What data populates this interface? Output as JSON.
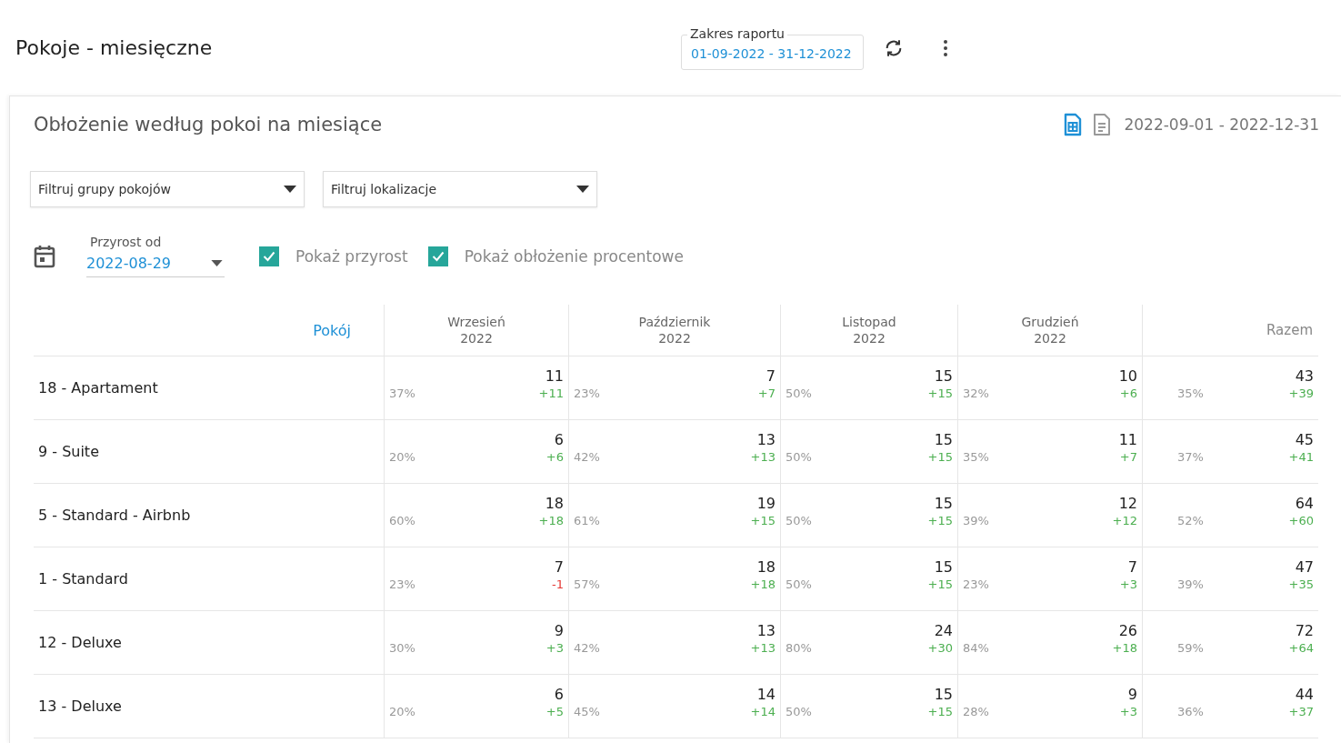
{
  "page_title": "Pokoje - miesięczne",
  "report_range": {
    "label": "Zakres raportu",
    "value": "01-09-2022 - 31-12-2022"
  },
  "card": {
    "title": "Obłożenie według pokoi na miesiące",
    "date_range": "2022-09-01 - 2022-12-31"
  },
  "filters": [
    {
      "placeholder": "Filtruj grupy pokojów"
    },
    {
      "placeholder": "Filtruj lokalizacje"
    }
  ],
  "growth_from": {
    "label": "Przyrost od",
    "value": "2022-08-29"
  },
  "checkboxes": [
    {
      "label": "Pokaż przyrost",
      "checked": true
    },
    {
      "label": "Pokaż obłożenie procentowe",
      "checked": true
    }
  ],
  "table": {
    "columns": [
      {
        "label": "Pokój",
        "kind": "room"
      },
      {
        "label": "Wrzesień",
        "year": "2022",
        "kind": "month"
      },
      {
        "label": "Październik",
        "year": "2022",
        "kind": "month"
      },
      {
        "label": "Listopad",
        "year": "2022",
        "kind": "month"
      },
      {
        "label": "Grudzień",
        "year": "2022",
        "kind": "month"
      },
      {
        "label": "Razem",
        "kind": "total"
      }
    ],
    "rows": [
      {
        "cells": [
          {
            "kind": "room",
            "text": "18 - Apartament"
          },
          {
            "kind": "count",
            "value": "11",
            "percent": "37%",
            "delta": "+11",
            "negative": false
          },
          {
            "kind": "count",
            "value": "7",
            "percent": "23%",
            "delta": "+7",
            "negative": false
          },
          {
            "kind": "count",
            "value": "15",
            "percent": "50%",
            "delta": "+15",
            "negative": false
          },
          {
            "kind": "count",
            "value": "10",
            "percent": "32%",
            "delta": "+6",
            "negative": false
          },
          {
            "kind": "count",
            "value": "43",
            "percent": "35%",
            "delta": "+39",
            "negative": false
          }
        ]
      },
      {
        "cells": [
          {
            "kind": "room",
            "text": "9 - Suite"
          },
          {
            "kind": "count",
            "value": "6",
            "percent": "20%",
            "delta": "+6",
            "negative": false
          },
          {
            "kind": "count",
            "value": "13",
            "percent": "42%",
            "delta": "+13",
            "negative": false
          },
          {
            "kind": "count",
            "value": "15",
            "percent": "50%",
            "delta": "+15",
            "negative": false
          },
          {
            "kind": "count",
            "value": "11",
            "percent": "35%",
            "delta": "+7",
            "negative": false
          },
          {
            "kind": "count",
            "value": "45",
            "percent": "37%",
            "delta": "+41",
            "negative": false
          }
        ]
      },
      {
        "cells": [
          {
            "kind": "room",
            "text": "5 - Standard - Airbnb"
          },
          {
            "kind": "count",
            "value": "18",
            "percent": "60%",
            "delta": "+18",
            "negative": false
          },
          {
            "kind": "count",
            "value": "19",
            "percent": "61%",
            "delta": "+15",
            "negative": false
          },
          {
            "kind": "count",
            "value": "15",
            "percent": "50%",
            "delta": "+15",
            "negative": false
          },
          {
            "kind": "count",
            "value": "12",
            "percent": "39%",
            "delta": "+12",
            "negative": false
          },
          {
            "kind": "count",
            "value": "64",
            "percent": "52%",
            "delta": "+60",
            "negative": false
          }
        ]
      },
      {
        "cells": [
          {
            "kind": "room",
            "text": "1 - Standard"
          },
          {
            "kind": "count",
            "value": "7",
            "percent": "23%",
            "delta": "-1",
            "negative": true
          },
          {
            "kind": "count",
            "value": "18",
            "percent": "57%",
            "delta": "+18",
            "negative": false
          },
          {
            "kind": "count",
            "value": "15",
            "percent": "50%",
            "delta": "+15",
            "negative": false
          },
          {
            "kind": "count",
            "value": "7",
            "percent": "23%",
            "delta": "+3",
            "negative": false
          },
          {
            "kind": "count",
            "value": "47",
            "percent": "39%",
            "delta": "+35",
            "negative": false
          }
        ]
      },
      {
        "cells": [
          {
            "kind": "room",
            "text": "12 - Deluxe"
          },
          {
            "kind": "count",
            "value": "9",
            "percent": "30%",
            "delta": "+3",
            "negative": false
          },
          {
            "kind": "count",
            "value": "13",
            "percent": "42%",
            "delta": "+13",
            "negative": false
          },
          {
            "kind": "count",
            "value": "24",
            "percent": "80%",
            "delta": "+30",
            "negative": false
          },
          {
            "kind": "count",
            "value": "26",
            "percent": "84%",
            "delta": "+18",
            "negative": false
          },
          {
            "kind": "count",
            "value": "72",
            "percent": "59%",
            "delta": "+64",
            "negative": false
          }
        ]
      },
      {
        "cells": [
          {
            "kind": "room",
            "text": "13 - Deluxe"
          },
          {
            "kind": "count",
            "value": "6",
            "percent": "20%",
            "delta": "+5",
            "negative": false
          },
          {
            "kind": "count",
            "value": "14",
            "percent": "45%",
            "delta": "+14",
            "negative": false
          },
          {
            "kind": "count",
            "value": "15",
            "percent": "50%",
            "delta": "+15",
            "negative": false
          },
          {
            "kind": "count",
            "value": "9",
            "percent": "28%",
            "delta": "+3",
            "negative": false
          },
          {
            "kind": "count",
            "value": "44",
            "percent": "36%",
            "delta": "+37",
            "negative": false
          }
        ]
      }
    ]
  }
}
